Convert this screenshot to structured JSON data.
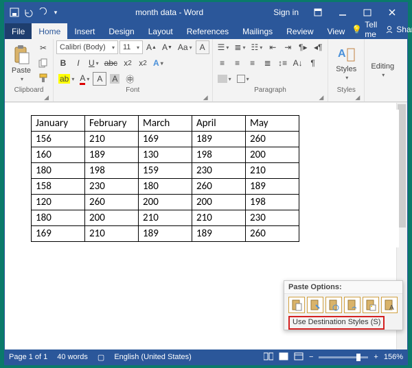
{
  "titlebar": {
    "doc_title": "month data - Word",
    "signin": "Sign in"
  },
  "tabs": {
    "file": "File",
    "home": "Home",
    "insert": "Insert",
    "design": "Design",
    "layout": "Layout",
    "references": "References",
    "mailings": "Mailings",
    "review": "Review",
    "view": "View",
    "tellme": "Tell me",
    "share": "Share"
  },
  "ribbon": {
    "clipboard": {
      "paste": "Paste",
      "label": "Clipboard"
    },
    "font": {
      "name": "Calibri (Body)",
      "size": "11",
      "label": "Font"
    },
    "paragraph": {
      "label": "Paragraph"
    },
    "styles": {
      "btn": "Styles",
      "label": "Styles"
    },
    "editing": {
      "btn": "Editing"
    }
  },
  "table": {
    "headers": [
      "January",
      "February",
      "March",
      "April",
      "May"
    ],
    "rows": [
      [
        "156",
        "210",
        "169",
        "189",
        "260"
      ],
      [
        "160",
        "189",
        "130",
        "198",
        "200"
      ],
      [
        "180",
        "198",
        "159",
        "230",
        "210"
      ],
      [
        "158",
        "230",
        "180",
        "260",
        "189"
      ],
      [
        "120",
        "260",
        "200",
        "200",
        "198"
      ],
      [
        "180",
        "200",
        "210",
        "210",
        "230"
      ],
      [
        "169",
        "210",
        "189",
        "189",
        "260"
      ]
    ]
  },
  "paste_popup": {
    "title": "Paste Options:",
    "highlighted": "Use Destination Styles (S)"
  },
  "statusbar": {
    "page": "Page 1 of 1",
    "words": "40 words",
    "lang": "English (United States)",
    "zoom_plus": "+",
    "zoom_minus": "−",
    "zoom": "156%"
  }
}
